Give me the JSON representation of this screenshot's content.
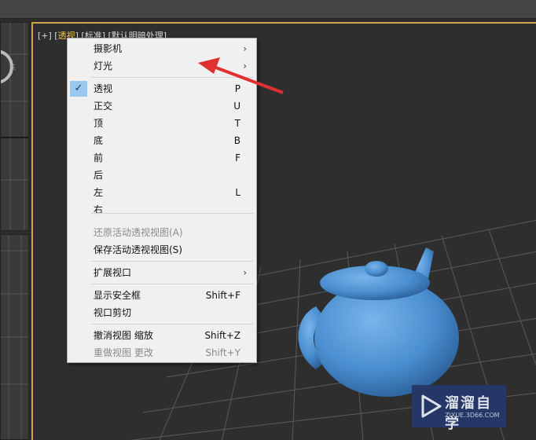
{
  "viewport": {
    "plus": "[+]",
    "view": "透视",
    "shading": "标准",
    "lighting": "默认明暗处理"
  },
  "left_viewport_label": "东",
  "menu": {
    "items": [
      {
        "label": "摄影机",
        "submenu": true
      },
      {
        "label": "灯光",
        "submenu": true
      },
      {
        "label": "透视",
        "key": "P",
        "checked": true
      },
      {
        "label": "正交",
        "key": "U"
      },
      {
        "label": "顶",
        "key": "T"
      },
      {
        "label": "底",
        "key": "B"
      },
      {
        "label": "前",
        "key": "F"
      },
      {
        "label": "后",
        "key": ""
      },
      {
        "label": "左",
        "key": "L"
      },
      {
        "label": "右",
        "key": ""
      },
      {
        "label": "还原活动透视视图(A)",
        "disabled": true
      },
      {
        "label": "保存活动透视视图(S)"
      },
      {
        "label": "扩展视口",
        "submenu": true
      },
      {
        "label": "显示安全框",
        "key": "Shift+F"
      },
      {
        "label": "视口剪切"
      },
      {
        "label": "撤消视图 缩放",
        "key": "Shift+Z"
      },
      {
        "label": "重做视图 更改",
        "key": "Shift+Y",
        "disabled": true
      }
    ]
  },
  "watermark": {
    "title": "溜溜自学",
    "url": "ZIXUE.3D66.COM"
  },
  "colors": {
    "accent": "#f2c64a",
    "teapot": "#4a8fd0",
    "arrow": "#e03030"
  }
}
